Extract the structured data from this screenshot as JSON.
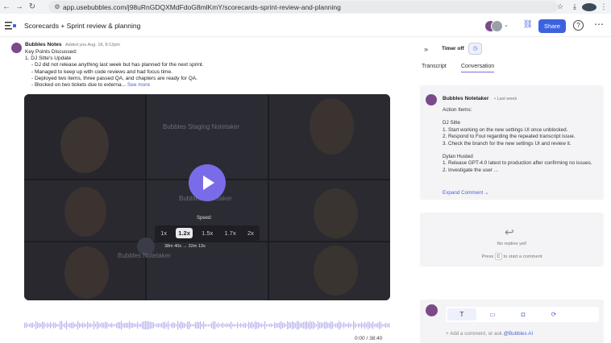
{
  "browser": {
    "url": "app.usebubbles.com/j98uRnGDQXMdFdoG8mlKmY/scorecards-sprint-review-and-planning",
    "profile_initial": "J"
  },
  "header": {
    "title": "Scorecards + Sprint review & planning",
    "share_label": "Share"
  },
  "note": {
    "author": "Bubbles Notes",
    "time": "Added you Aug. 18, 8:12pm",
    "lines": [
      "Key Points Discussed:",
      "1. DJ Sitte's Update",
      "- DJ did not release anything last week but has planned for the next sprint.",
      "- Managed to keep up with code reviews and had focus time.",
      "- Deployed two items, three passed QA, and chapters are ready for QA.",
      "- Blocked on two tickets due to externa..."
    ],
    "see_more": "See more"
  },
  "video": {
    "tile_label_1": "Bubbles Staging Notetaker",
    "tile_label_2": "Bubbles Notetaker",
    "tile_label_3": "Bubbles Notetaker",
    "speed_label": "Speed:",
    "speeds": [
      "1x",
      "1.2x",
      "1.5x",
      "1.7x",
      "2x"
    ],
    "active_speed": "1.2x",
    "duration_text": "38m 40s → 32m 13s"
  },
  "player": {
    "time": "0:00 / 38:40"
  },
  "panel": {
    "timer_label": "Timer off",
    "tabs": [
      "Transcript",
      "Conversation"
    ],
    "active_tab": "Conversation"
  },
  "comment": {
    "author": "Bubbles Notetaker",
    "time": "• Last week",
    "lines": [
      "Action Items:",
      "",
      "DJ Sitte",
      "1. Start working on the new settings UI once unblocked.",
      "2. Respond to Foul regarding the repeated transcript issue.",
      "3. Check the branch for the new settings UI and review it.",
      "",
      "Dylan Husted",
      "1. Release GPT-4.0 latest to production after confirming no issues.",
      "2. Investigate the user ..."
    ],
    "expand_label": "Expand Comment"
  },
  "replies": {
    "empty_text": "No replies yet!",
    "press_prefix": "Press",
    "press_key": "C",
    "press_suffix": "to start a comment"
  },
  "composer": {
    "placeholder_prefix": "+ Add a comment, or ask",
    "mention": "@Bubbles AI"
  },
  "colors": {
    "accent": "#7a6ce8",
    "link": "#4a63d6",
    "share": "#3d62e0"
  }
}
